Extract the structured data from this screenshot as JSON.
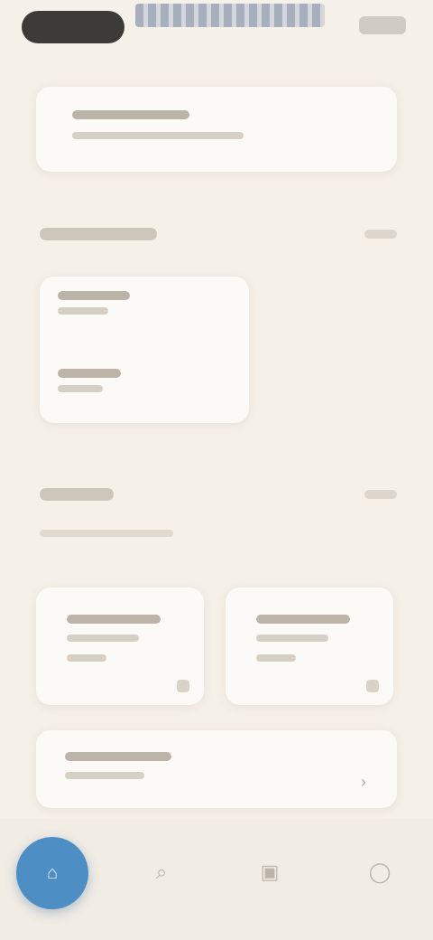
{
  "status_bar": {},
  "top_card": {},
  "section_1": {},
  "section_2": {},
  "tiles": [
    {},
    {}
  ],
  "wide_card": {},
  "bottom_nav": {
    "items": [
      "home",
      "search",
      "bag",
      "profile"
    ],
    "active": "home"
  },
  "colors": {
    "background": "#f5f0e8",
    "card": "#fbfaf7",
    "accent": "#4d8ec4",
    "status_pill": "#3d3a37"
  }
}
